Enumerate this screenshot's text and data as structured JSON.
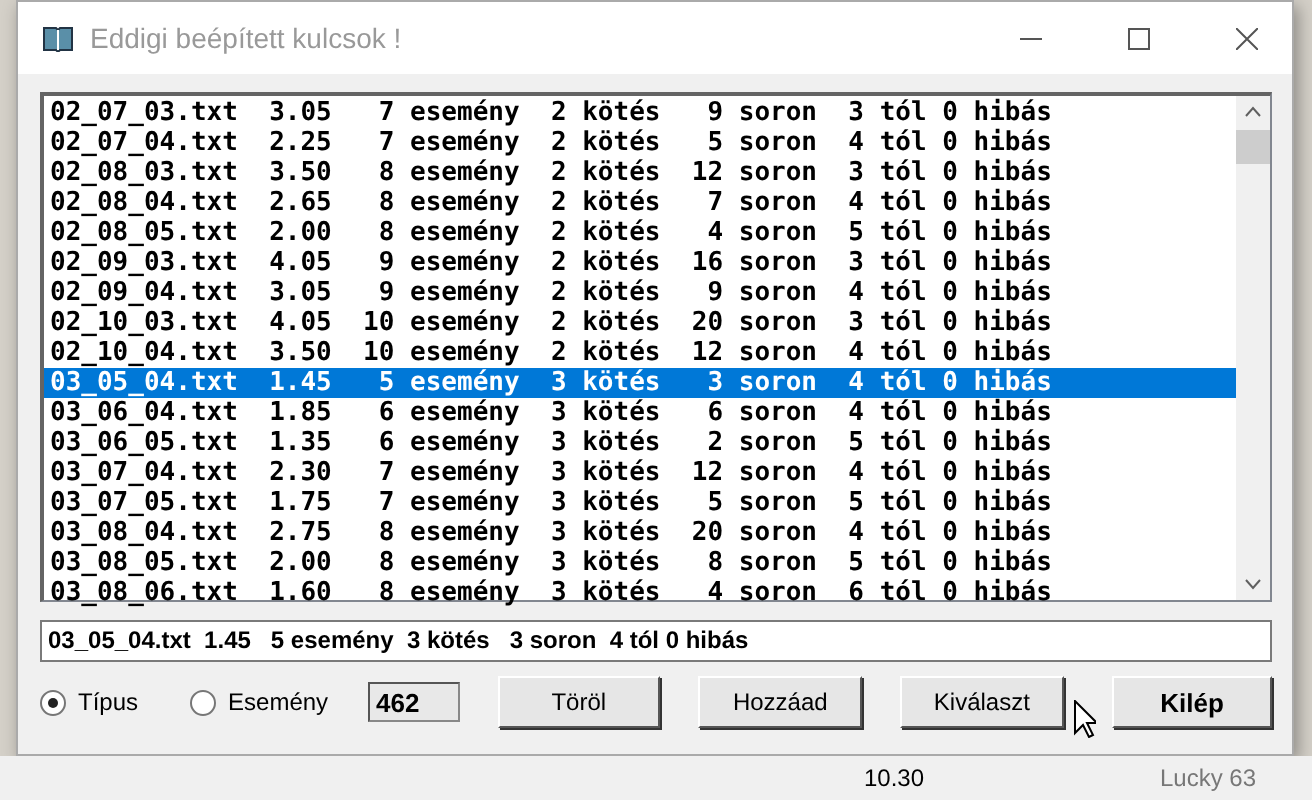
{
  "window": {
    "title": "Eddigi beépített kulcsok !"
  },
  "list": {
    "rows": [
      {
        "text": "02_07_03.txt  3.05   7 esemény  2 kötés   9 soron  3 tól 0 hibás",
        "selected": false
      },
      {
        "text": "02_07_04.txt  2.25   7 esemény  2 kötés   5 soron  4 tól 0 hibás",
        "selected": false
      },
      {
        "text": "02_08_03.txt  3.50   8 esemény  2 kötés  12 soron  3 tól 0 hibás",
        "selected": false
      },
      {
        "text": "02_08_04.txt  2.65   8 esemény  2 kötés   7 soron  4 tól 0 hibás",
        "selected": false
      },
      {
        "text": "02_08_05.txt  2.00   8 esemény  2 kötés   4 soron  5 tól 0 hibás",
        "selected": false
      },
      {
        "text": "02_09_03.txt  4.05   9 esemény  2 kötés  16 soron  3 tól 0 hibás",
        "selected": false
      },
      {
        "text": "02_09_04.txt  3.05   9 esemény  2 kötés   9 soron  4 tól 0 hibás",
        "selected": false
      },
      {
        "text": "02_10_03.txt  4.05  10 esemény  2 kötés  20 soron  3 tól 0 hibás",
        "selected": false
      },
      {
        "text": "02_10_04.txt  3.50  10 esemény  2 kötés  12 soron  4 tól 0 hibás",
        "selected": false
      },
      {
        "text": "03_05_04.txt  1.45   5 esemény  3 kötés   3 soron  4 tól 0 hibás",
        "selected": true
      },
      {
        "text": "03_06_04.txt  1.85   6 esemény  3 kötés   6 soron  4 tól 0 hibás",
        "selected": false
      },
      {
        "text": "03_06_05.txt  1.35   6 esemény  3 kötés   2 soron  5 tól 0 hibás",
        "selected": false
      },
      {
        "text": "03_07_04.txt  2.30   7 esemény  3 kötés  12 soron  4 tól 0 hibás",
        "selected": false
      },
      {
        "text": "03_07_05.txt  1.75   7 esemény  3 kötés   5 soron  5 tól 0 hibás",
        "selected": false
      },
      {
        "text": "03_08_04.txt  2.75   8 esemény  3 kötés  20 soron  4 tól 0 hibás",
        "selected": false
      },
      {
        "text": "03_08_05.txt  2.00   8 esemény  3 kötés   8 soron  5 tól 0 hibás",
        "selected": false
      },
      {
        "text": "03_08_06.txt  1.60   8 esemény  3 kötés   4 soron  6 tól 0 hibás",
        "selected": false
      }
    ]
  },
  "detail": {
    "value": "03_05_04.txt  1.45   5 esemény  3 kötés   3 soron  4 tól 0 hibás"
  },
  "options": [
    {
      "label": "Típus",
      "selected": true
    },
    {
      "label": "Esemény",
      "selected": false
    }
  ],
  "count": "462",
  "buttons": [
    {
      "label": "Töröl",
      "default": false
    },
    {
      "label": "Hozzáad",
      "default": false
    },
    {
      "label": "Kiválaszt",
      "default": false
    },
    {
      "label": "Kilép",
      "default": true
    }
  ],
  "background": {
    "texts": [
      "10.30",
      "Lucky 63"
    ]
  }
}
